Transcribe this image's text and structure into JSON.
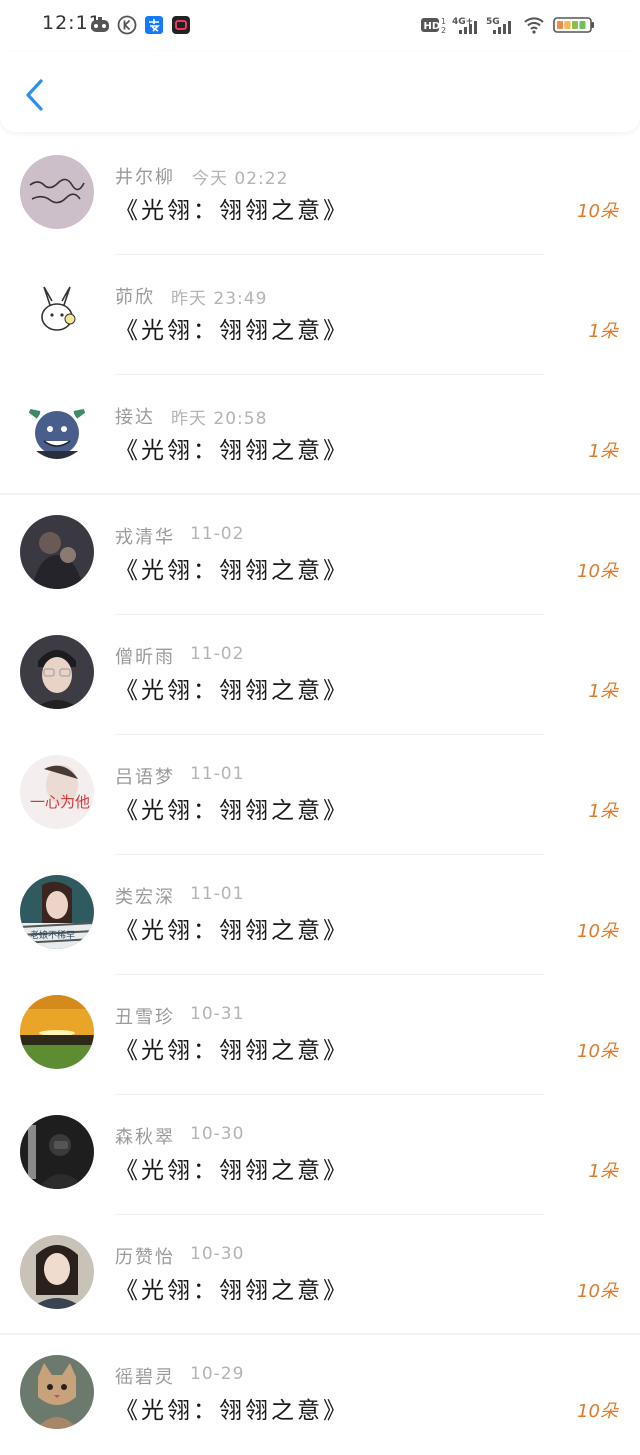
{
  "status_bar": {
    "time": "12:11",
    "icons": [
      "gamepad-icon",
      "k-icon",
      "alipay-icon",
      "video-app-icon",
      "hd-icon",
      "signal-4g-icon",
      "signal-5g-icon",
      "wifi-icon",
      "battery-icon"
    ],
    "hd_label": "HD",
    "net_4g": "4G⁺",
    "net_5g": "5G"
  },
  "header": {
    "back_icon": "chevron-left-icon"
  },
  "records": [
    {
      "name": "井尔柳",
      "time": "今天 02:22",
      "title": "《光翎：翎翎之意》",
      "amount": "10朵"
    },
    {
      "name": "茆欣",
      "time": "昨天 23:49",
      "title": "《光翎：翎翎之意》",
      "amount": "1朵"
    },
    {
      "name": "接达",
      "time": "昨天 20:58",
      "title": "《光翎：翎翎之意》",
      "amount": "1朵"
    },
    {
      "name": "戎清华",
      "time": "11-02",
      "title": "《光翎：翎翎之意》",
      "amount": "10朵"
    },
    {
      "name": "僧昕雨",
      "time": "11-02",
      "title": "《光翎：翎翎之意》",
      "amount": "1朵"
    },
    {
      "name": "吕语梦",
      "time": "11-01",
      "title": "《光翎：翎翎之意》",
      "amount": "1朵"
    },
    {
      "name": "类宏深",
      "time": "11-01",
      "title": "《光翎：翎翎之意》",
      "amount": "10朵"
    },
    {
      "name": "丑雪珍",
      "time": "10-31",
      "title": "《光翎：翎翎之意》",
      "amount": "10朵"
    },
    {
      "name": "森秋翠",
      "time": "10-30",
      "title": "《光翎：翎翎之意》",
      "amount": "1朵"
    },
    {
      "name": "历赞怡",
      "time": "10-30",
      "title": "《光翎：翎翎之意》",
      "amount": "10朵"
    },
    {
      "name": "徭碧灵",
      "time": "10-29",
      "title": "《光翎：翎翎之意》",
      "amount": "10朵"
    }
  ],
  "colors": {
    "accent_blue": "#2b8ff0",
    "amount_orange": "#e07a2a"
  }
}
